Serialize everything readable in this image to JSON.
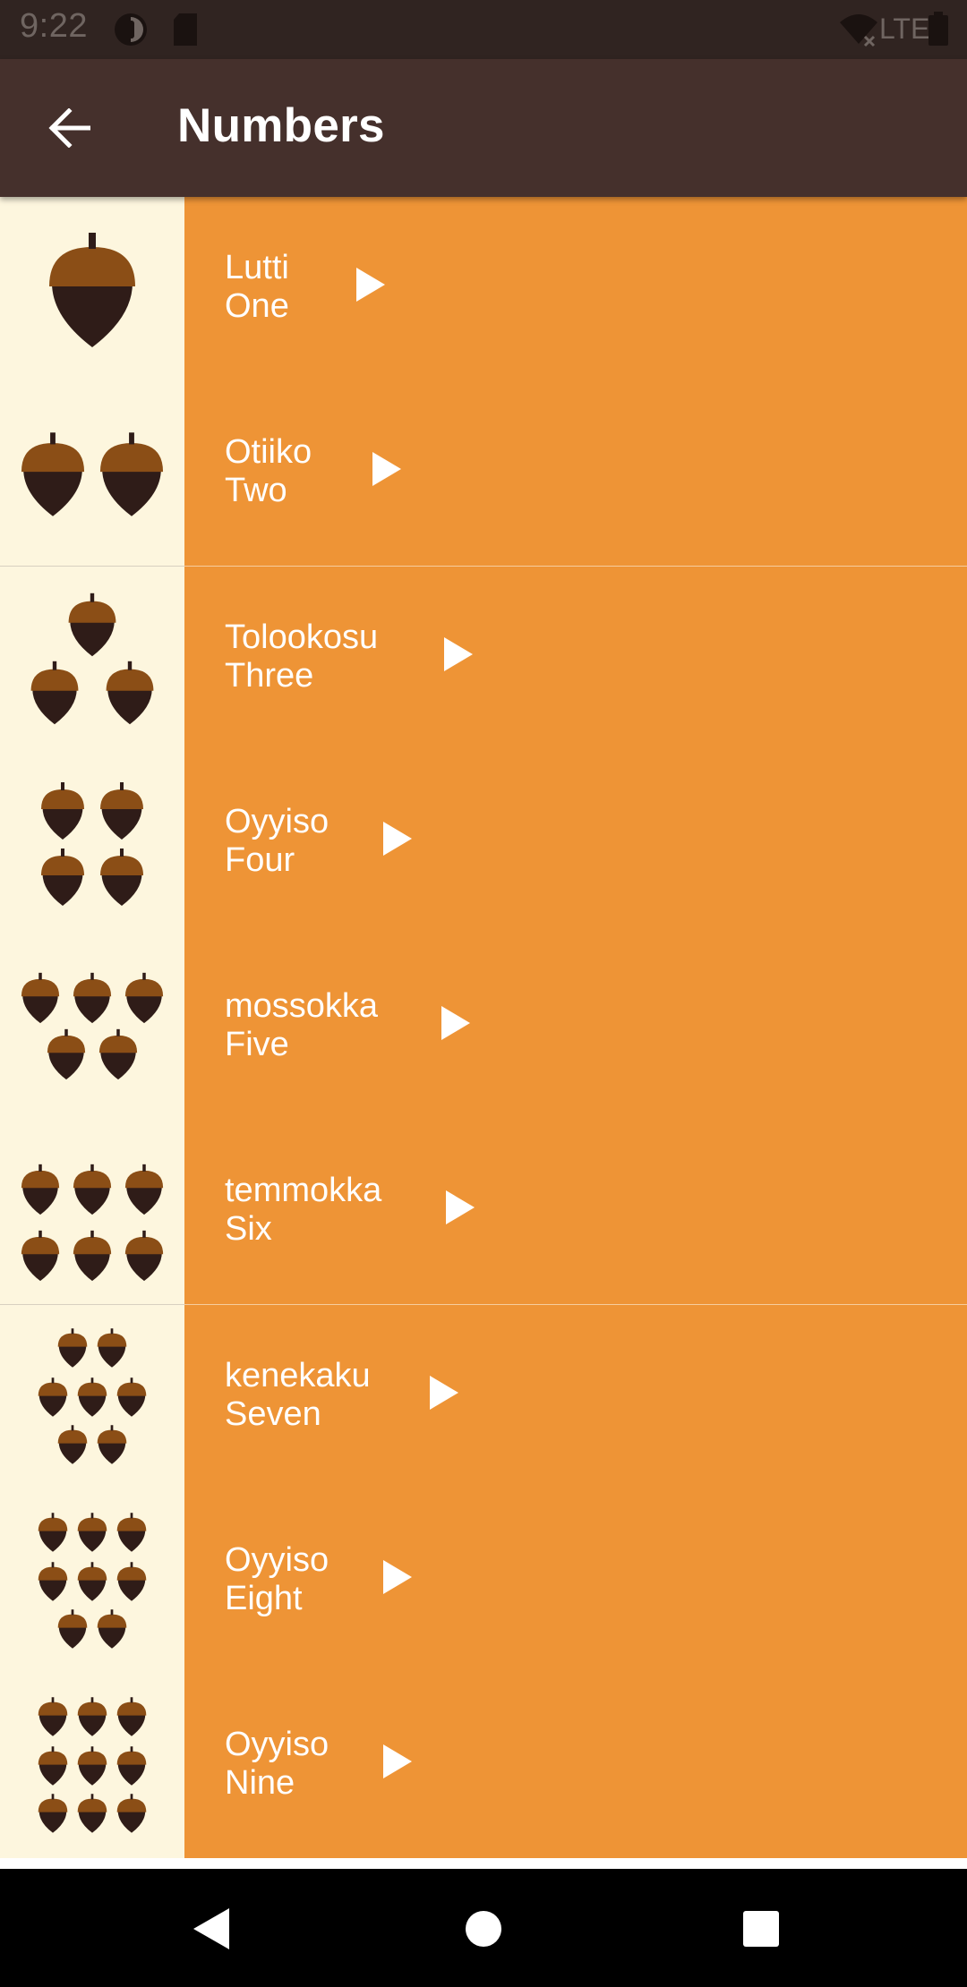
{
  "status_bar": {
    "time": "9:22",
    "network": "LTE"
  },
  "app_bar": {
    "title": "Numbers",
    "back_icon": "arrow-back-icon"
  },
  "colors": {
    "status_bar": "#302421",
    "app_bar": "#45302c",
    "row_background": "#ee9436",
    "image_background": "#fdf6de",
    "acorn_cap": "#8b4e16",
    "acorn_body": "#2f1c18"
  },
  "numbers": [
    {
      "miwok": "Lutti",
      "english": "One",
      "acorns": 1
    },
    {
      "miwok": "Otiiko",
      "english": "Two",
      "acorns": 2
    },
    {
      "miwok": "Tolookosu",
      "english": "Three",
      "acorns": 3
    },
    {
      "miwok": "Oyyiso",
      "english": "Four",
      "acorns": 4
    },
    {
      "miwok": "mossokka",
      "english": "Five",
      "acorns": 5
    },
    {
      "miwok": "temmokka",
      "english": "Six",
      "acorns": 6
    },
    {
      "miwok": "kenekaku",
      "english": "Seven",
      "acorns": 7
    },
    {
      "miwok": "Oyyiso",
      "english": "Eight",
      "acorns": 8
    },
    {
      "miwok": "Oyyiso",
      "english": "Nine",
      "acorns": 9
    }
  ],
  "nav_bar": {
    "back": "back-triangle-icon",
    "home": "home-circle-icon",
    "recents": "recents-square-icon"
  }
}
